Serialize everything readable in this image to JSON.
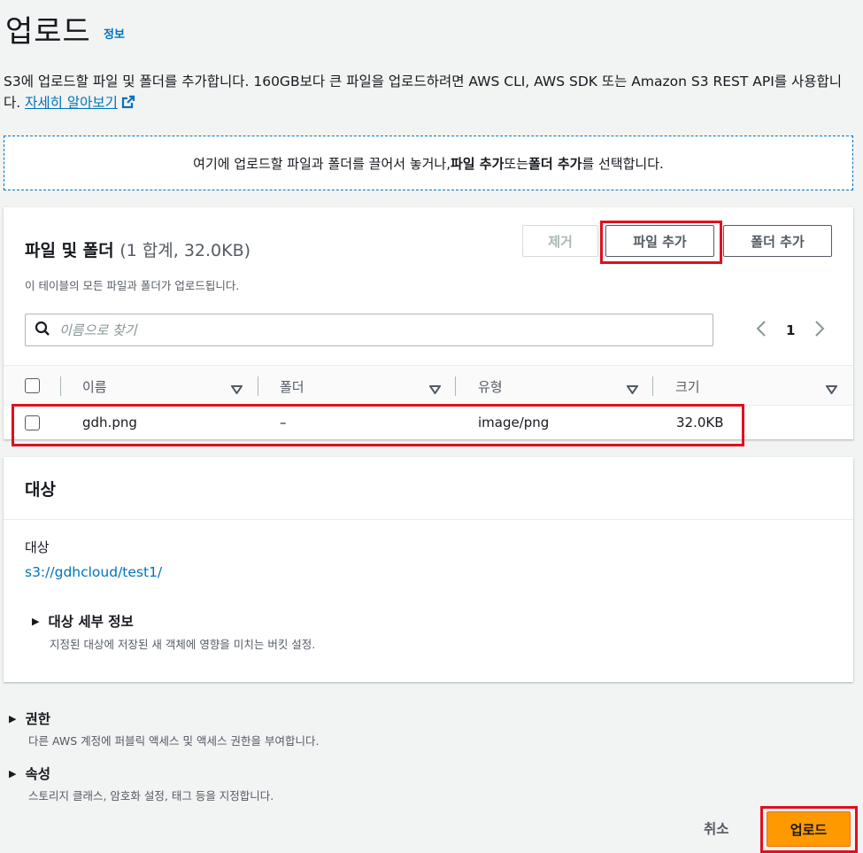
{
  "header": {
    "title": "업로드",
    "info_link": "정보"
  },
  "intro": {
    "text": "S3에 업로드할 파일 및 폴더를 추가합니다. 160GB보다 큰 파일을 업로드하려면 AWS CLI, AWS SDK 또는 Amazon S3 REST API를 사용합니다. ",
    "learn_more": "자세히 알아보기"
  },
  "dropzone": {
    "prefix": "여기에 업로드할 파일과 폴더를 끌어서 놓거나, ",
    "add_files": "파일 추가",
    "middle": " 또는 ",
    "add_folder": "폴더 추가",
    "suffix": "를 선택합니다."
  },
  "files": {
    "title": "파일 및 폴더",
    "count": "(1 합계, 32.0KB)",
    "description": "이 테이블의 모든 파일과 폴더가 업로드됩니다.",
    "remove_label": "제거",
    "add_files_label": "파일 추가",
    "add_folder_label": "폴더 추가",
    "search_placeholder": "이름으로 찾기",
    "page_number": "1",
    "columns": [
      "이름",
      "폴더",
      "유형",
      "크기"
    ],
    "rows": [
      {
        "name": "gdh.png",
        "folder": "–",
        "type": "image/png",
        "size": "32.0KB"
      }
    ]
  },
  "destination": {
    "title": "대상",
    "label": "대상",
    "url": "s3://gdhcloud/test1/",
    "details_title": "대상 세부 정보",
    "details_desc": "지정된 대상에 저장된 새 객체에 영향을 미치는 버킷 설정."
  },
  "permissions": {
    "title": "권한",
    "desc": "다른 AWS 계정에 퍼블릭 액세스 및 액세스 권한을 부여합니다."
  },
  "properties": {
    "title": "속성",
    "desc": "스토리지 클래스, 암호화 설정, 태그 등을 지정합니다."
  },
  "footer": {
    "cancel_label": "취소",
    "upload_label": "업로드"
  },
  "colors": {
    "link": "#0073bb",
    "primary_button": "#ff9900",
    "highlight": "#e0101f"
  }
}
